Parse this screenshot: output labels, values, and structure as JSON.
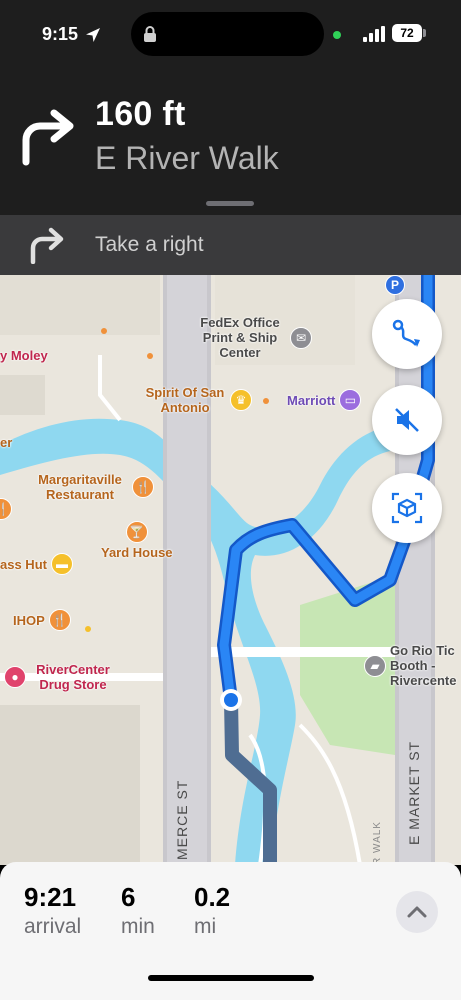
{
  "status": {
    "time": "9:15",
    "battery": "72"
  },
  "maneuver": {
    "distance": "160 ft",
    "street": "E River Walk",
    "icon": "turn-right-arrow-icon"
  },
  "next": {
    "instruction": "Take a right",
    "icon": "turn-right-arrow-icon"
  },
  "map": {
    "pois": {
      "moley": "y Moley",
      "fedex": "FedEx Office Print & Ship Center",
      "spirit": "Spirit Of San Antonio",
      "marriott": "Marriott",
      "er": "er",
      "margaritaville": "Margaritaville Restaurant",
      "yardhouse": "Yard House",
      "hut": "ass Hut",
      "ihop": "IHOP",
      "rivercenter": "RiverCenter Drug Store",
      "gorio": "Go Rio Tic Booth - Rivercente"
    },
    "streets": {
      "commerce": "MERCE ST",
      "market": "E MARKET ST",
      "riverwalk": "R WALK"
    },
    "parking": "P"
  },
  "controls": {
    "route_overview": "route-icon",
    "mute": "speaker-muted-icon",
    "view3d": "3d-view-icon"
  },
  "eta": {
    "arrival": {
      "value": "9:21",
      "unit": "arrival"
    },
    "duration": {
      "value": "6",
      "unit": "min"
    },
    "distance": {
      "value": "0.2",
      "unit": "mi"
    }
  },
  "colors": {
    "route": "#1a73e8",
    "traveled": "#4f6d92",
    "water": "#8fd8f0"
  }
}
